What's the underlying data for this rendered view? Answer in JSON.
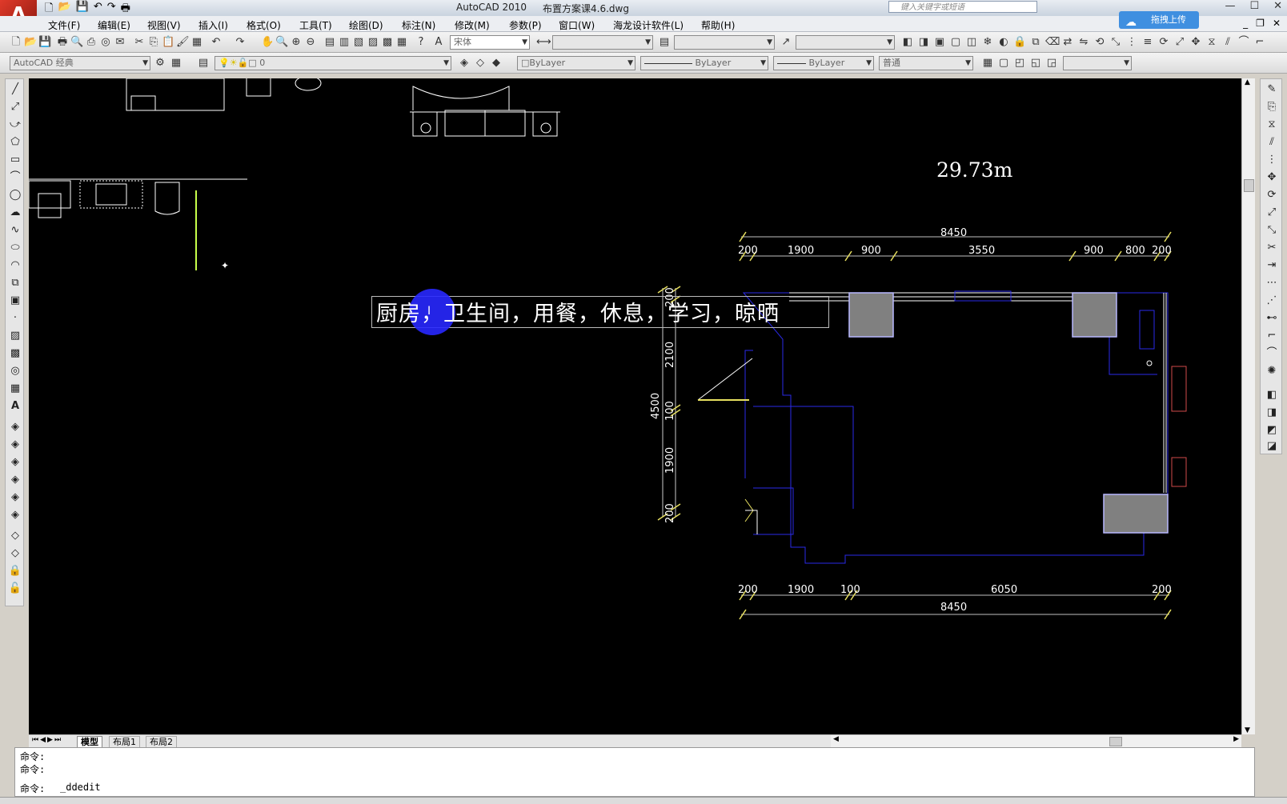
{
  "window": {
    "app_title": "AutoCAD 2010",
    "file_name": "布置方案课4.6.dwg",
    "search_placeholder": "键入关键字或短语",
    "upload_button": "拖拽上传",
    "logo_letter": "A"
  },
  "menu": {
    "items": [
      "文件(F)",
      "编辑(E)",
      "视图(V)",
      "插入(I)",
      "格式(O)",
      "工具(T)",
      "绘图(D)",
      "标注(N)",
      "修改(M)",
      "参数(P)",
      "窗口(W)",
      "海龙设计软件(L)",
      "帮助(H)"
    ]
  },
  "toolbar": {
    "text_style": "宋体",
    "workspace": "AutoCAD 经典",
    "layer": "0",
    "color": "ByLayer",
    "linetype": "ByLayer",
    "lineweight": "ByLayer",
    "plot_style": "普通"
  },
  "drawing": {
    "mtext": "厨房，卫生间，用餐，休息，学习，晾晒",
    "area": "29.73m",
    "dims_top_total": "8450",
    "dims_top": [
      "200",
      "1900",
      "900",
      "3550",
      "900",
      "800",
      "200"
    ],
    "dims_bottom": [
      "200",
      "1900",
      "100",
      "6050",
      "200"
    ],
    "dims_bottom_total": "8450",
    "dims_left_total": "4500",
    "dims_left": [
      "200",
      "2100",
      "100",
      "1900",
      "200"
    ]
  },
  "tabs": {
    "model": "模型",
    "layout1": "布局1",
    "layout2": "布局2"
  },
  "command": {
    "line1": "命令:",
    "line2": "命令:",
    "line3_prompt": "命令:",
    "line3_value": "_ddedit"
  }
}
